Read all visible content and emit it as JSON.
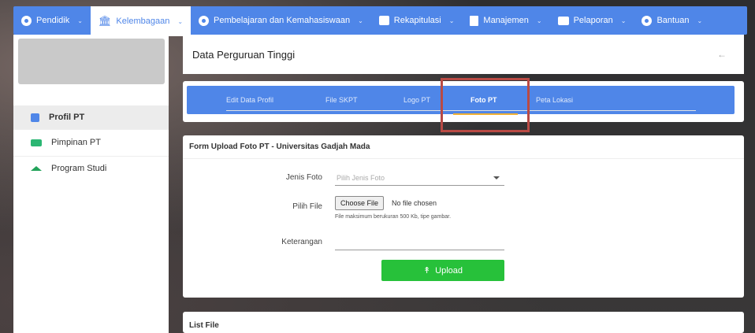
{
  "topnav": {
    "items": [
      {
        "label": "Pendidik",
        "icon": "user-circle-icon"
      },
      {
        "label": "Kelembagaan",
        "icon": "bank-icon"
      },
      {
        "label": "Pembelajaran dan Kemahasiswaan",
        "icon": "user-circle-icon"
      },
      {
        "label": "Rekapitulasi",
        "icon": "chart-icon"
      },
      {
        "label": "Manajemen",
        "icon": "document-icon"
      },
      {
        "label": "Pelaporan",
        "icon": "folder-icon"
      },
      {
        "label": "Bantuan",
        "icon": "user-circle-icon"
      }
    ],
    "active": "Kelembagaan",
    "chevron": "⌄"
  },
  "sidebar": {
    "items": [
      {
        "label": "Profil PT",
        "icon": "id-card-icon"
      },
      {
        "label": "Pimpinan PT",
        "icon": "contacts-icon"
      },
      {
        "label": "Program Studi",
        "icon": "graduation-cap-icon"
      }
    ],
    "active": "Profil PT"
  },
  "header": {
    "title": "Data Perguruan Tinggi",
    "back": "←"
  },
  "tabs": {
    "items": [
      "Edit Data Profil",
      "File SKPT",
      "Logo PT",
      "Foto PT",
      "Peta Lokasi"
    ],
    "active": "Foto PT"
  },
  "form": {
    "title": "Form Upload Foto PT - Universitas Gadjah Mada",
    "jenis_label": "Jenis Foto",
    "jenis_placeholder": "Pilih Jenis Foto",
    "file_label": "Pilih File",
    "file_button": "Choose File",
    "file_status": "No file chosen",
    "file_hint": "File maksimum berukuran 500 Kb, tipe gambar.",
    "ket_label": "Keterangan",
    "upload_icon": "↟",
    "upload_label": "Upload"
  },
  "list": {
    "title": "List File"
  },
  "colors": {
    "primary": "#4f86e8",
    "upload": "#27c13a",
    "highlight": "#b94a44",
    "tab_underline": "#f2b134"
  }
}
